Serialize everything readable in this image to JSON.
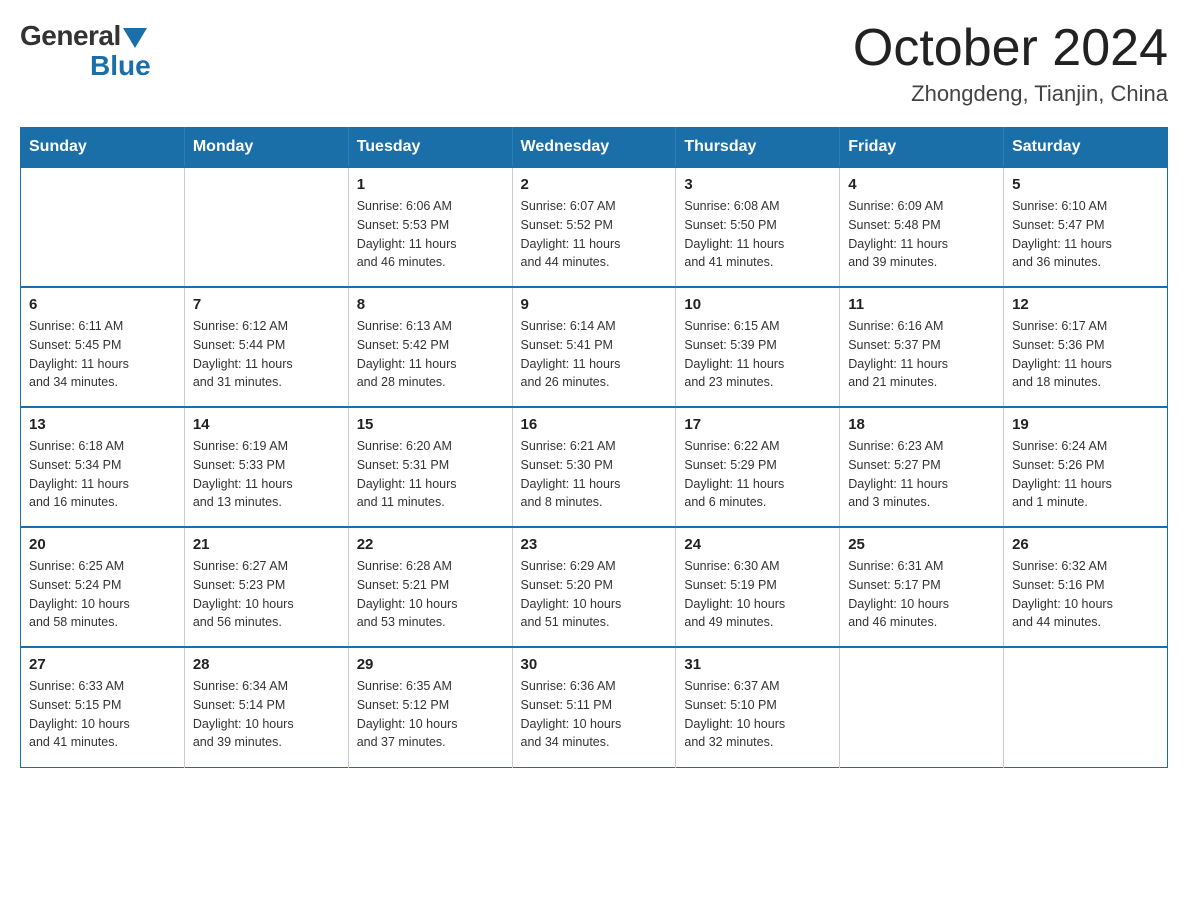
{
  "logo": {
    "general": "General",
    "blue": "Blue"
  },
  "header": {
    "month": "October 2024",
    "location": "Zhongdeng, Tianjin, China"
  },
  "weekdays": [
    "Sunday",
    "Monday",
    "Tuesday",
    "Wednesday",
    "Thursday",
    "Friday",
    "Saturday"
  ],
  "weeks": [
    [
      {
        "day": "",
        "info": ""
      },
      {
        "day": "",
        "info": ""
      },
      {
        "day": "1",
        "info": "Sunrise: 6:06 AM\nSunset: 5:53 PM\nDaylight: 11 hours\nand 46 minutes."
      },
      {
        "day": "2",
        "info": "Sunrise: 6:07 AM\nSunset: 5:52 PM\nDaylight: 11 hours\nand 44 minutes."
      },
      {
        "day": "3",
        "info": "Sunrise: 6:08 AM\nSunset: 5:50 PM\nDaylight: 11 hours\nand 41 minutes."
      },
      {
        "day": "4",
        "info": "Sunrise: 6:09 AM\nSunset: 5:48 PM\nDaylight: 11 hours\nand 39 minutes."
      },
      {
        "day": "5",
        "info": "Sunrise: 6:10 AM\nSunset: 5:47 PM\nDaylight: 11 hours\nand 36 minutes."
      }
    ],
    [
      {
        "day": "6",
        "info": "Sunrise: 6:11 AM\nSunset: 5:45 PM\nDaylight: 11 hours\nand 34 minutes."
      },
      {
        "day": "7",
        "info": "Sunrise: 6:12 AM\nSunset: 5:44 PM\nDaylight: 11 hours\nand 31 minutes."
      },
      {
        "day": "8",
        "info": "Sunrise: 6:13 AM\nSunset: 5:42 PM\nDaylight: 11 hours\nand 28 minutes."
      },
      {
        "day": "9",
        "info": "Sunrise: 6:14 AM\nSunset: 5:41 PM\nDaylight: 11 hours\nand 26 minutes."
      },
      {
        "day": "10",
        "info": "Sunrise: 6:15 AM\nSunset: 5:39 PM\nDaylight: 11 hours\nand 23 minutes."
      },
      {
        "day": "11",
        "info": "Sunrise: 6:16 AM\nSunset: 5:37 PM\nDaylight: 11 hours\nand 21 minutes."
      },
      {
        "day": "12",
        "info": "Sunrise: 6:17 AM\nSunset: 5:36 PM\nDaylight: 11 hours\nand 18 minutes."
      }
    ],
    [
      {
        "day": "13",
        "info": "Sunrise: 6:18 AM\nSunset: 5:34 PM\nDaylight: 11 hours\nand 16 minutes."
      },
      {
        "day": "14",
        "info": "Sunrise: 6:19 AM\nSunset: 5:33 PM\nDaylight: 11 hours\nand 13 minutes."
      },
      {
        "day": "15",
        "info": "Sunrise: 6:20 AM\nSunset: 5:31 PM\nDaylight: 11 hours\nand 11 minutes."
      },
      {
        "day": "16",
        "info": "Sunrise: 6:21 AM\nSunset: 5:30 PM\nDaylight: 11 hours\nand 8 minutes."
      },
      {
        "day": "17",
        "info": "Sunrise: 6:22 AM\nSunset: 5:29 PM\nDaylight: 11 hours\nand 6 minutes."
      },
      {
        "day": "18",
        "info": "Sunrise: 6:23 AM\nSunset: 5:27 PM\nDaylight: 11 hours\nand 3 minutes."
      },
      {
        "day": "19",
        "info": "Sunrise: 6:24 AM\nSunset: 5:26 PM\nDaylight: 11 hours\nand 1 minute."
      }
    ],
    [
      {
        "day": "20",
        "info": "Sunrise: 6:25 AM\nSunset: 5:24 PM\nDaylight: 10 hours\nand 58 minutes."
      },
      {
        "day": "21",
        "info": "Sunrise: 6:27 AM\nSunset: 5:23 PM\nDaylight: 10 hours\nand 56 minutes."
      },
      {
        "day": "22",
        "info": "Sunrise: 6:28 AM\nSunset: 5:21 PM\nDaylight: 10 hours\nand 53 minutes."
      },
      {
        "day": "23",
        "info": "Sunrise: 6:29 AM\nSunset: 5:20 PM\nDaylight: 10 hours\nand 51 minutes."
      },
      {
        "day": "24",
        "info": "Sunrise: 6:30 AM\nSunset: 5:19 PM\nDaylight: 10 hours\nand 49 minutes."
      },
      {
        "day": "25",
        "info": "Sunrise: 6:31 AM\nSunset: 5:17 PM\nDaylight: 10 hours\nand 46 minutes."
      },
      {
        "day": "26",
        "info": "Sunrise: 6:32 AM\nSunset: 5:16 PM\nDaylight: 10 hours\nand 44 minutes."
      }
    ],
    [
      {
        "day": "27",
        "info": "Sunrise: 6:33 AM\nSunset: 5:15 PM\nDaylight: 10 hours\nand 41 minutes."
      },
      {
        "day": "28",
        "info": "Sunrise: 6:34 AM\nSunset: 5:14 PM\nDaylight: 10 hours\nand 39 minutes."
      },
      {
        "day": "29",
        "info": "Sunrise: 6:35 AM\nSunset: 5:12 PM\nDaylight: 10 hours\nand 37 minutes."
      },
      {
        "day": "30",
        "info": "Sunrise: 6:36 AM\nSunset: 5:11 PM\nDaylight: 10 hours\nand 34 minutes."
      },
      {
        "day": "31",
        "info": "Sunrise: 6:37 AM\nSunset: 5:10 PM\nDaylight: 10 hours\nand 32 minutes."
      },
      {
        "day": "",
        "info": ""
      },
      {
        "day": "",
        "info": ""
      }
    ]
  ]
}
